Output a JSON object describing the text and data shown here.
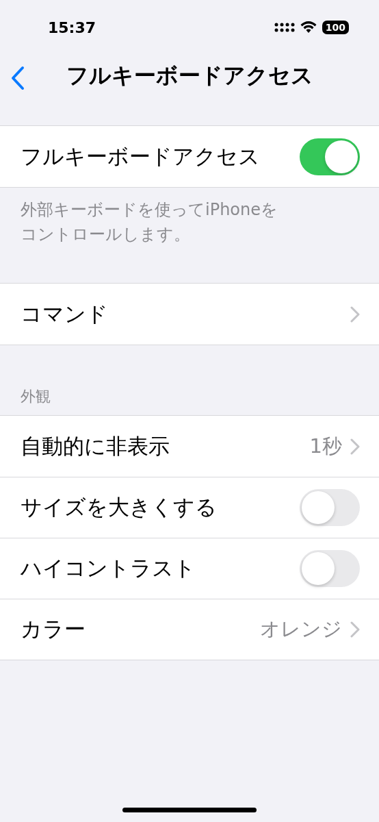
{
  "status_bar": {
    "time": "15:37",
    "battery": "100"
  },
  "nav": {
    "title": "フルキーボードアクセス"
  },
  "groups": [
    {
      "rows": [
        {
          "kind": "toggle",
          "label": "フルキーボードアクセス",
          "on": true
        }
      ],
      "footer": "外部キーボードを使ってiPhoneをコントロールします。"
    },
    {
      "rows": [
        {
          "kind": "link",
          "label": "コマンド"
        }
      ]
    },
    {
      "header": "外観",
      "rows": [
        {
          "kind": "link",
          "label": "自動的に非表示",
          "value": "1秒"
        },
        {
          "kind": "toggle",
          "label": "サイズを大きくする",
          "on": false
        },
        {
          "kind": "toggle",
          "label": "ハイコントラスト",
          "on": false
        },
        {
          "kind": "link",
          "label": "カラー",
          "value": "オレンジ"
        }
      ]
    }
  ]
}
